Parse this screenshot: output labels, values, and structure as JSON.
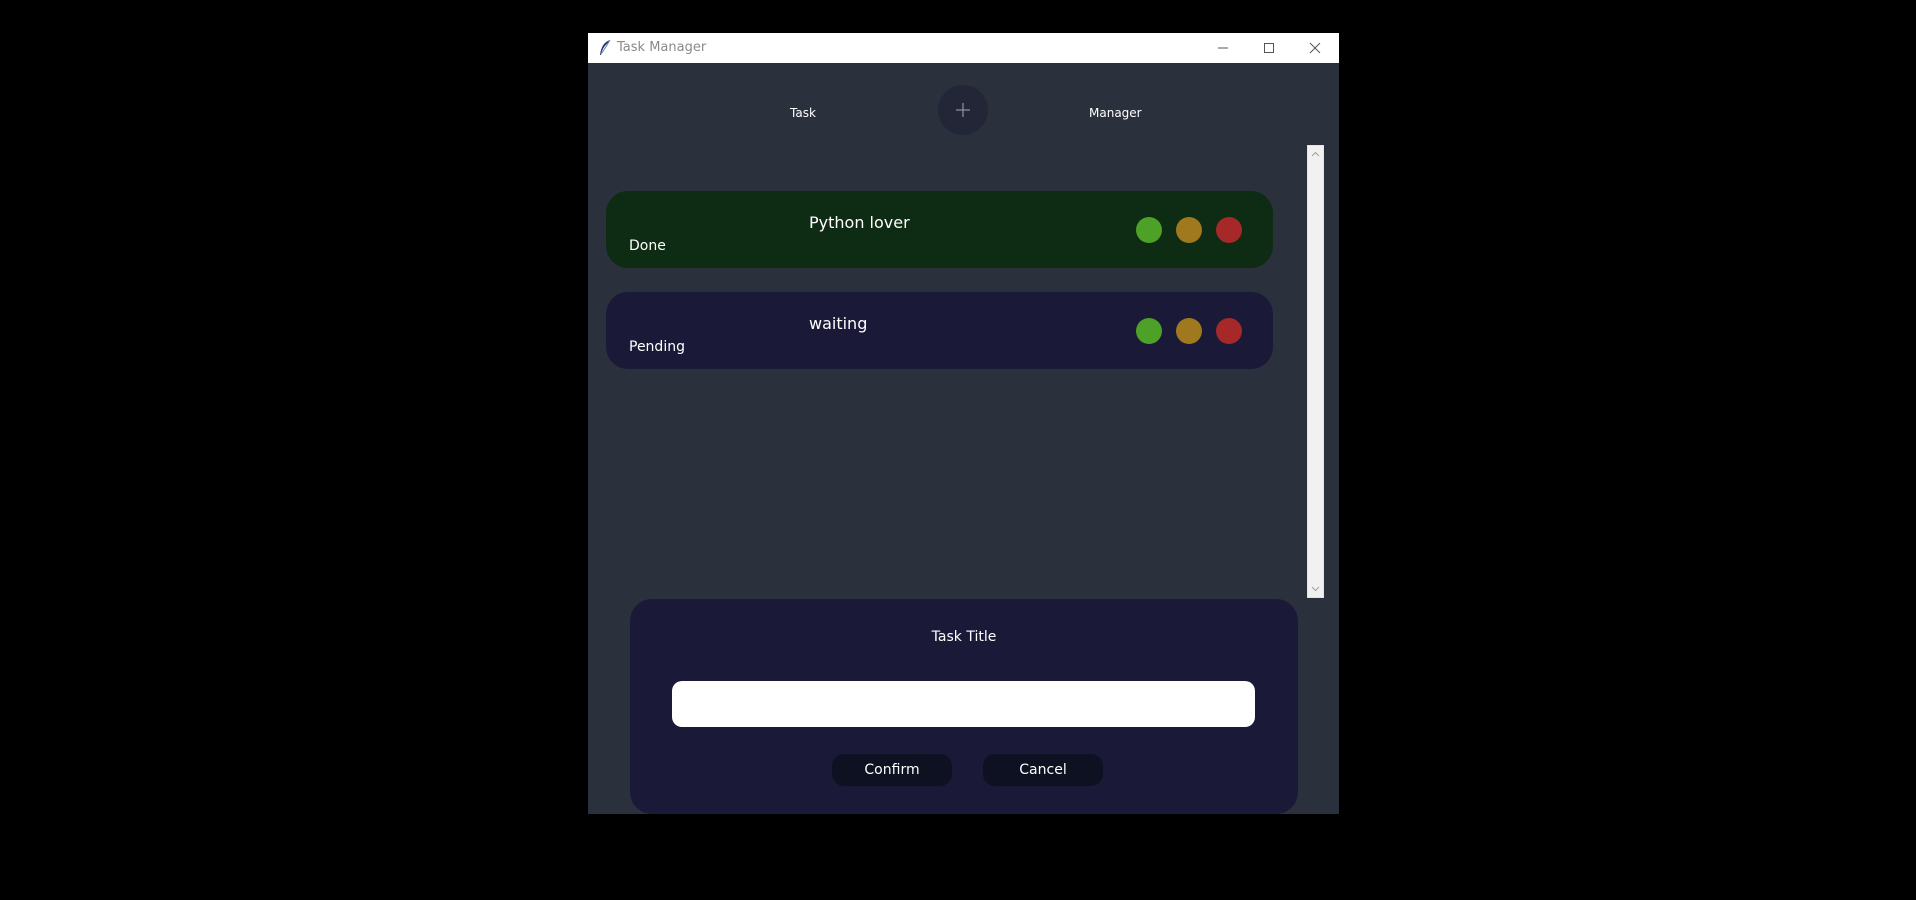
{
  "window": {
    "title": "Task Manager"
  },
  "header": {
    "left_label": "Task",
    "right_label": "Manager",
    "add_icon": "plus-icon"
  },
  "tasks": [
    {
      "title": "Python lover",
      "status": "Done",
      "card_color": "#0e2b13"
    },
    {
      "title": "waiting",
      "status": "Pending",
      "card_color": "#1b1938"
    }
  ],
  "status_colors": {
    "done": "#4da126",
    "pending": "#a0791f",
    "delete": "#a62828"
  },
  "dialog": {
    "title": "Task Title",
    "input_value": "",
    "confirm_label": "Confirm",
    "cancel_label": "Cancel"
  }
}
